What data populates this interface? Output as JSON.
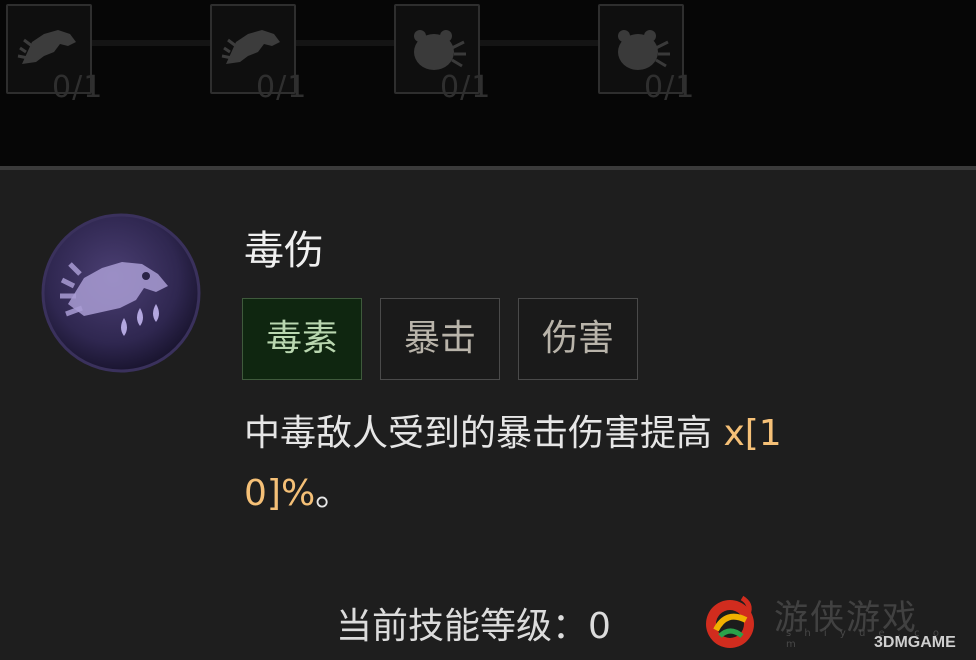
{
  "talent_row": {
    "nodes": [
      {
        "icon": "wolf-icon",
        "count": "0/1"
      },
      {
        "icon": "wolf-icon",
        "count": "0/1"
      },
      {
        "icon": "bear-icon",
        "count": "0/1"
      },
      {
        "icon": "bear-icon",
        "count": "0/1"
      }
    ]
  },
  "skill": {
    "icon": "wolf-poison-icon",
    "title": "毒伤",
    "tags": [
      "毒素",
      "暴击",
      "伤害"
    ],
    "desc_text": "中毒敌人受到的暴击伤害提高 ",
    "desc_value_a": "x[1",
    "desc_value_b": "0]%",
    "desc_end": "。",
    "level_label": "当前技能等级：",
    "level_value": "0"
  },
  "colors": {
    "value_highlight": "#f5c077",
    "poison_tag_bg": "#0f2610",
    "icon_purple": "#5a4a86"
  },
  "watermark": {
    "cn": "游侠游戏",
    "sub": "s h i y u e . c o m",
    "brand": "3DMGAME"
  }
}
